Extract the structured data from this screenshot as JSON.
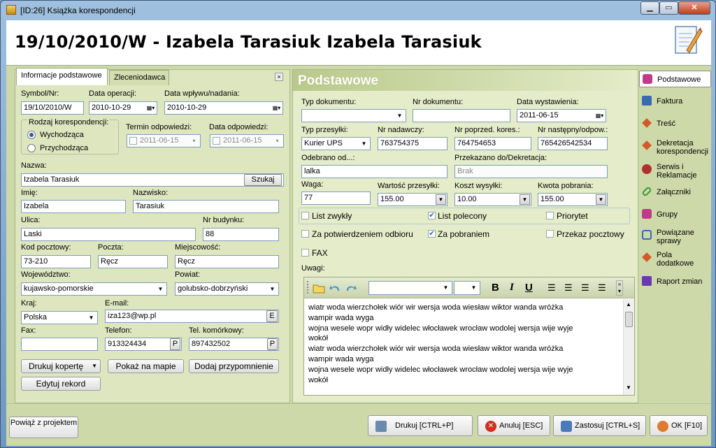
{
  "window": {
    "title": "[ID:26] Książka korespondencji",
    "min": "▁",
    "max": "▭",
    "close": "✕"
  },
  "header": {
    "title": "19/10/2010/W - Izabela Tarasiuk Izabela Tarasiuk"
  },
  "tabs": [
    "Informacje podstawowe",
    "Zleceniodawca"
  ],
  "left": {
    "symbol_label": "Symbol/Nr:",
    "symbol_value": "19/10/2010/W",
    "data_operacji_label": "Data operacji:",
    "data_operacji_value": "2010-10-29",
    "data_wplywu_label": "Data wpływu/nadania:",
    "data_wplywu_value": "2010-10-29",
    "rodzaj_label": "Rodzaj korespondencji:",
    "rodzaj_opt1": "Wychodząca",
    "rodzaj_opt2": "Przychodząca",
    "termin_label": "Termin odpowiedzi:",
    "termin_value": "2011-06-15",
    "data_odp_label": "Data odpowiedzi:",
    "data_odp_value": "2011-06-15",
    "nazwa_label": "Nazwa:",
    "nazwa_value": "Izabela Tarasiuk",
    "szukaj": "Szukaj",
    "imie_label": "Imię:",
    "imie_value": "Izabela",
    "nazwisko_label": "Nazwisko:",
    "nazwisko_value": "Tarasiuk",
    "ulica_label": "Ulica:",
    "ulica_value": "Laski",
    "nr_bud_label": "Nr budynku:",
    "nr_bud_value": "88",
    "kod_label": "Kod pocztowy:",
    "kod_value": "73-210",
    "poczta_label": "Poczta:",
    "poczta_value": "Ręcz",
    "miejsc_label": "Miejscowość:",
    "miejsc_value": "Ręcz",
    "woj_label": "Województwo:",
    "woj_value": "kujawsko-pomorskie",
    "powiat_label": "Powiat:",
    "powiat_value": "golubsko-dobrzyński",
    "kraj_label": "Kraj:",
    "kraj_value": "Polska",
    "email_label": "E-mail:",
    "email_value": "iza123@wp.pl",
    "email_btn": "E",
    "fax_label": "Fax:",
    "fax_value": "",
    "telefon_label": "Telefon:",
    "telefon_value": "913324434",
    "tel_btn": "P",
    "kom_label": "Tel. komórkowy:",
    "kom_value": "897432502",
    "kom_btn": "P",
    "btn_koperta": "Drukuj kopertę",
    "btn_mapa": "Pokaż na mapie",
    "btn_przypomnienie": "Dodaj przypomnienie",
    "btn_edytuj": "Edytuj rekord"
  },
  "right": {
    "section_title": "Podstawowe",
    "typ_dok_label": "Typ dokumentu:",
    "typ_dok_value": "",
    "nr_dok_label": "Nr dokumentu:",
    "nr_dok_value": "",
    "data_wyst_label": "Data wystawienia:",
    "data_wyst_value": "2011-06-15",
    "typ_przes_label": "Typ przesyłki:",
    "typ_przes_value": "Kurier UPS",
    "nr_nad_label": "Nr nadawczy:",
    "nr_nad_value": "763754375",
    "nr_poprz_label": "Nr poprzed. kores.:",
    "nr_poprz_value": "764754653",
    "nr_nast_label": "Nr następny/odpow.:",
    "nr_nast_value": "765426542534",
    "odebrano_label": "Odebrano od...:",
    "odebrano_value": "lalka",
    "przekazano_label": "Przekazano do/Dekretacja:",
    "przekazano_value": "Brak",
    "waga_label": "Waga:",
    "waga_value": "77",
    "wartosc_label": "Wartość przesyłki:",
    "wartosc_value": "155.00",
    "koszt_label": "Koszt wysyłki:",
    "koszt_value": "10.00",
    "kwota_label": "Kwota pobrania:",
    "kwota_value": "155.00",
    "chk_list_zwykly": "List zwykły",
    "chk_list_polecony": "List polecony",
    "chk_priorytet": "Priorytet",
    "chk_potw": "Za potwierdzeniem odbioru",
    "chk_pobranie": "Za pobraniem",
    "chk_przekaz": "Przekaz pocztowy",
    "chk_fax": "FAX",
    "uwagi_label": "Uwagi:",
    "uwagi_lines": [
      "wiatr woda wierzchołek wiór wir wersja woda wiesław wiktor wanda wróżka",
      "wampir wada wyga",
      "wojna wesele wopr widły widelec włocławek wrocław wodolej wersja wije wyje",
      "wokół",
      "wiatr woda wierzchołek wiór wir wersja woda wiesław wiktor wanda wróżka",
      "wampir wada wyga",
      "wojna wesele wopr widły widelec włocławek wrocław wodolej wersja wije wyje",
      "wokół"
    ],
    "toolbar": {
      "bold": "B",
      "italic": "I",
      "underline": "U"
    }
  },
  "nav": [
    {
      "label": "Podstawowe",
      "icon": "cube-icon",
      "color": "#c03a8a"
    },
    {
      "label": "Faktura",
      "icon": "invoice-icon",
      "color": "#3a6ab0"
    },
    {
      "label": "Treść",
      "icon": "pencil-icon",
      "color": "#d05a2a"
    },
    {
      "label": "Dekretacja korespondencji",
      "icon": "pencil-icon",
      "color": "#d05a2a"
    },
    {
      "label": "Serwis i Reklamacje",
      "icon": "people-icon",
      "color": "#b03030"
    },
    {
      "label": "Załączniki",
      "icon": "paperclip-icon",
      "color": "#3a9a3a"
    },
    {
      "label": "Grupy",
      "icon": "group-icon",
      "color": "#c03a8a"
    },
    {
      "label": "Powiązane sprawy",
      "icon": "link-icon",
      "color": "#3a6ab0"
    },
    {
      "label": "Pola dodatkowe",
      "icon": "pencil-icon",
      "color": "#d05a2a"
    },
    {
      "label": "Raport zmian",
      "icon": "report-icon",
      "color": "#6a3ab0"
    }
  ],
  "footer": {
    "btn_powiaz": "Powiąż z projektem",
    "btn_drukuj": "Drukuj [CTRL+P]",
    "btn_anuluj": "Anuluj [ESC]",
    "btn_zastosuj": "Zastosuj [CTRL+S]",
    "btn_ok": "OK [F10]"
  }
}
